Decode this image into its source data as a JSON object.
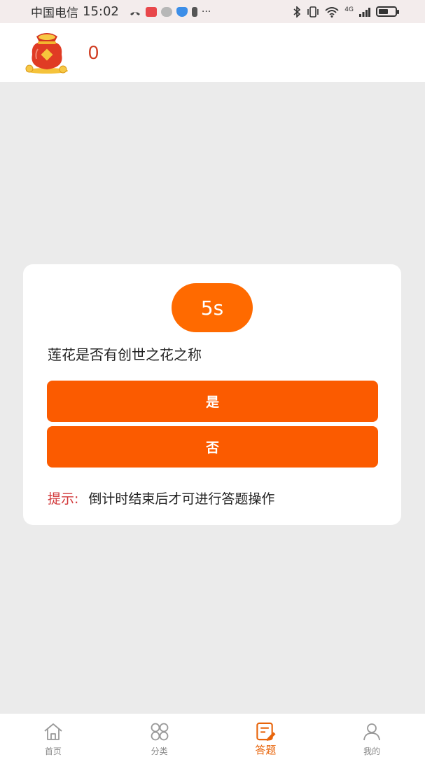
{
  "status_bar": {
    "carrier": "中国电信",
    "time": "15:02",
    "network": "4G"
  },
  "header": {
    "coin_icon": "money-bag-icon",
    "coin_count": "0"
  },
  "quiz": {
    "timer": "5s",
    "question": "莲花是否有创世之花之称",
    "options": [
      "是",
      "否"
    ],
    "hint_label": "提示:",
    "hint_text": "倒计时结束后才可进行答题操作"
  },
  "bottom_nav": {
    "items": [
      {
        "label": "首页",
        "icon": "home-icon",
        "active": false
      },
      {
        "label": "分类",
        "icon": "category-icon",
        "active": false
      },
      {
        "label": "答题",
        "icon": "quiz-icon",
        "active": true
      },
      {
        "label": "我的",
        "icon": "profile-icon",
        "active": false
      }
    ]
  },
  "colors": {
    "accent": "#fb5b00",
    "timer": "#ff6a00",
    "hint_label": "#d2393b",
    "coin_count": "#cf3a1f",
    "nav_active": "#e8640a"
  }
}
